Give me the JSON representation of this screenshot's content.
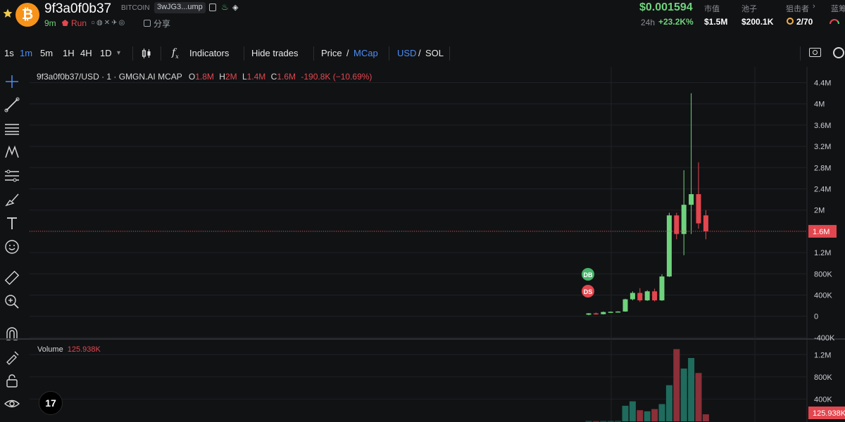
{
  "header": {
    "title": "9f3a0f0b37",
    "chain": "BITCOIN",
    "address": "3wJG3...ump",
    "age": "9m",
    "run_label": "Run",
    "share_label": "分享",
    "price": "$0.001594",
    "change_label": "24h",
    "change_value": "+23.2K%",
    "stats": [
      {
        "label": "市值",
        "value": "$1.5M"
      },
      {
        "label": "池子",
        "value": "$200.1K"
      },
      {
        "label": "狙击者",
        "value": "2/70"
      },
      {
        "label": "蓝筹",
        "value": ""
      }
    ],
    "icons": [
      "star-icon",
      "bitcoin-logo-icon",
      "copy-icon",
      "fire-icon",
      "pill-icon",
      "run-icon",
      "social-icons",
      "share-icon",
      "chevron-right-icon",
      "gauge-icon"
    ]
  },
  "toolbar": {
    "intervals": [
      {
        "label": "1s",
        "active": false
      },
      {
        "label": "1m",
        "active": true
      },
      {
        "label": "5m",
        "active": false
      },
      {
        "label": "1H",
        "active": false
      },
      {
        "label": "4H",
        "active": false
      },
      {
        "label": "1D",
        "active": false
      }
    ],
    "interval_more": "▾",
    "indicators_label": "Indicators",
    "hide_trades_label": "Hide trades",
    "price_label": "Price",
    "mcap_label": "MCap",
    "usd_label": "USD",
    "sol_label": "SOL",
    "slash": "/",
    "colors": {
      "active": "#4b8ef5",
      "up": "#6fd37d",
      "down": "#e2474f"
    }
  },
  "legend": {
    "symbol": "9f3a0f0b37/USD · 1 · GMGN.AI MCAP",
    "o_key": "O",
    "o_val": "1.8M",
    "h_key": "H",
    "h_val": "2M",
    "l_key": "L",
    "l_val": "1.4M",
    "c_key": "C",
    "c_val": "1.6M",
    "change": "-190.8K (−10.69%)"
  },
  "volume_legend": {
    "label": "Volume",
    "value": "125.938K"
  },
  "markers": [
    {
      "label": "DB",
      "color": "#47b36a"
    },
    {
      "label": "DS",
      "color": "#e2474f"
    }
  ],
  "chart_data": {
    "type": "candlestick",
    "price_axis_ticks": [
      "4.4M",
      "4M",
      "3.6M",
      "3.2M",
      "2.8M",
      "2.4M",
      "2M",
      "1.6M",
      "1.2M",
      "800K",
      "400K",
      "0",
      "-400K"
    ],
    "price_ticks_values": [
      4400000,
      4000000,
      3600000,
      3200000,
      2800000,
      2400000,
      2000000,
      1600000,
      1200000,
      800000,
      400000,
      0,
      -400000
    ],
    "price_ylim": [
      -400000,
      4500000
    ],
    "last_value_label": "1.6M",
    "last_value": 1600000,
    "candles": [
      {
        "o": 30000,
        "h": 60000,
        "l": 20000,
        "c": 55000
      },
      {
        "o": 55000,
        "h": 70000,
        "l": 30000,
        "c": 40000
      },
      {
        "o": 40000,
        "h": 90000,
        "l": 35000,
        "c": 80000
      },
      {
        "o": 80000,
        "h": 90000,
        "l": 70000,
        "c": 85000
      },
      {
        "o": 85000,
        "h": 95000,
        "l": 75000,
        "c": 90000
      },
      {
        "o": 90000,
        "h": 330000,
        "l": 85000,
        "c": 320000
      },
      {
        "o": 320000,
        "h": 470000,
        "l": 300000,
        "c": 440000
      },
      {
        "o": 440000,
        "h": 530000,
        "l": 270000,
        "c": 300000
      },
      {
        "o": 300000,
        "h": 490000,
        "l": 290000,
        "c": 470000
      },
      {
        "o": 470000,
        "h": 520000,
        "l": 280000,
        "c": 300000
      },
      {
        "o": 300000,
        "h": 790000,
        "l": 290000,
        "c": 750000
      },
      {
        "o": 750000,
        "h": 1950000,
        "l": 740000,
        "c": 1900000
      },
      {
        "o": 1900000,
        "h": 1950000,
        "l": 1450000,
        "c": 1550000
      },
      {
        "o": 1550000,
        "h": 2750000,
        "l": 1150000,
        "c": 2100000
      },
      {
        "o": 2100000,
        "h": 4200000,
        "l": 1550000,
        "c": 2300000
      },
      {
        "o": 2300000,
        "h": 2900000,
        "l": 1650000,
        "c": 1750000
      },
      {
        "o": 1900000,
        "h": 2000000,
        "l": 1450000,
        "c": 1600000
      }
    ],
    "volume_axis_ticks": [
      "1.2M",
      "800K",
      "400K"
    ],
    "volume_ticks_values": [
      1200000,
      800000,
      400000
    ],
    "volume_ylim": [
      0,
      1330000
    ],
    "volume_last_label": "125.938K",
    "volumes": [
      5000,
      3000,
      5000,
      5000,
      6000,
      280000,
      360000,
      200000,
      180000,
      220000,
      310000,
      650000,
      1300000,
      950000,
      1140000,
      870000,
      126000
    ]
  }
}
